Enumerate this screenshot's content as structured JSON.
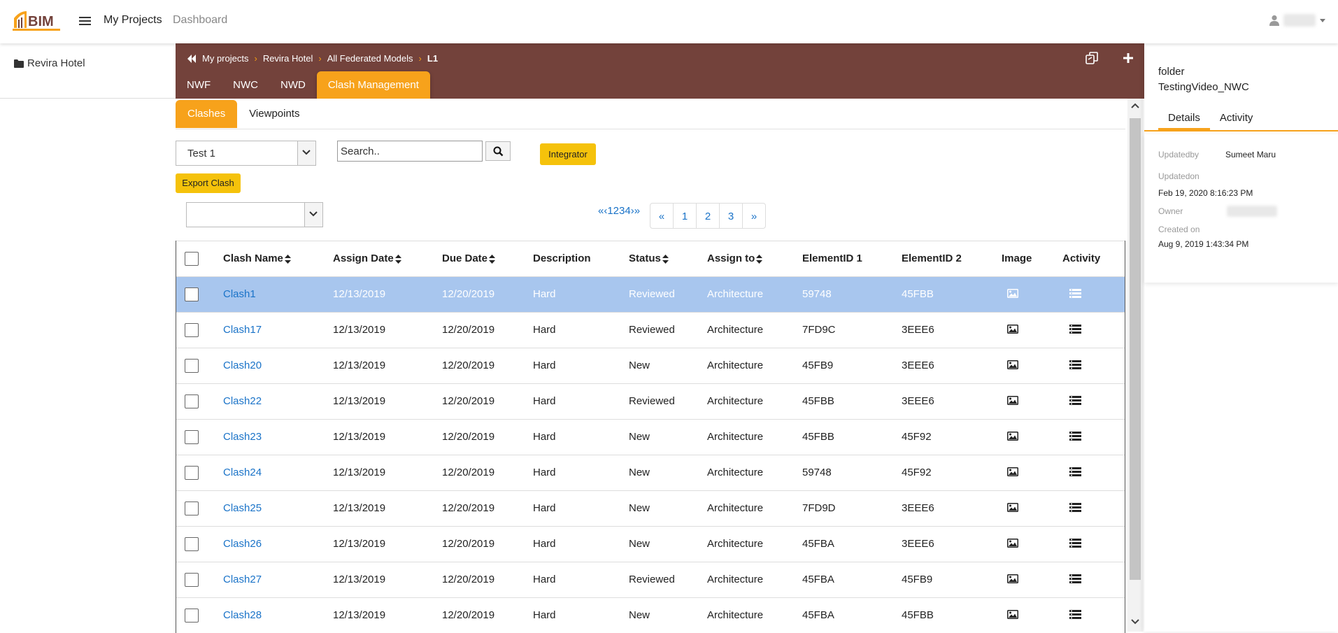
{
  "app": {
    "logo_text": "BIM",
    "nav": {
      "projects": "My Projects",
      "dashboard": "Dashboard"
    }
  },
  "sidebar": {
    "project": "Revira Hotel"
  },
  "breadcrumb": {
    "items": [
      "My projects",
      "Revira Hotel",
      "All Federated Models",
      "L1"
    ]
  },
  "tabs": [
    "NWF",
    "NWC",
    "NWD",
    "Clash Management"
  ],
  "subtabs": [
    "Clashes",
    "Viewpoints"
  ],
  "filters": {
    "test_select": "Test 1",
    "search_placeholder": "Search..",
    "integrator_label": "Integrator",
    "export_label": "Export Clash",
    "secondary_select": ""
  },
  "pagination": {
    "text": "«‹1234›»",
    "buttons": [
      "«",
      "1",
      "2",
      "3",
      "»"
    ]
  },
  "table": {
    "headers": {
      "name": "Clash Name",
      "assign_date": "Assign Date",
      "due_date": "Due Date",
      "description": "Description",
      "status": "Status",
      "assign_to": "Assign to",
      "element1": "ElementID 1",
      "element2": "ElementID 2",
      "image": "Image",
      "activity": "Activity"
    },
    "rows": [
      {
        "name": "Clash1",
        "assign": "12/13/2019",
        "due": "12/20/2019",
        "desc": "Hard",
        "status": "Reviewed",
        "to": "Architecture",
        "e1": "59748",
        "e2": "45FBB"
      },
      {
        "name": "Clash17",
        "assign": "12/13/2019",
        "due": "12/20/2019",
        "desc": "Hard",
        "status": "Reviewed",
        "to": "Architecture",
        "e1": "7FD9C",
        "e2": "3EEE6"
      },
      {
        "name": "Clash20",
        "assign": "12/13/2019",
        "due": "12/20/2019",
        "desc": "Hard",
        "status": "New",
        "to": "Architecture",
        "e1": "45FB9",
        "e2": "3EEE6"
      },
      {
        "name": "Clash22",
        "assign": "12/13/2019",
        "due": "12/20/2019",
        "desc": "Hard",
        "status": "Reviewed",
        "to": "Architecture",
        "e1": "45FBB",
        "e2": "3EEE6"
      },
      {
        "name": "Clash23",
        "assign": "12/13/2019",
        "due": "12/20/2019",
        "desc": "Hard",
        "status": "New",
        "to": "Architecture",
        "e1": "45FBB",
        "e2": "45F92"
      },
      {
        "name": "Clash24",
        "assign": "12/13/2019",
        "due": "12/20/2019",
        "desc": "Hard",
        "status": "New",
        "to": "Architecture",
        "e1": "59748",
        "e2": "45F92"
      },
      {
        "name": "Clash25",
        "assign": "12/13/2019",
        "due": "12/20/2019",
        "desc": "Hard",
        "status": "New",
        "to": "Architecture",
        "e1": "7FD9D",
        "e2": "3EEE6"
      },
      {
        "name": "Clash26",
        "assign": "12/13/2019",
        "due": "12/20/2019",
        "desc": "Hard",
        "status": "New",
        "to": "Architecture",
        "e1": "45FBA",
        "e2": "3EEE6"
      },
      {
        "name": "Clash27",
        "assign": "12/13/2019",
        "due": "12/20/2019",
        "desc": "Hard",
        "status": "Reviewed",
        "to": "Architecture",
        "e1": "45FBA",
        "e2": "45FB9"
      },
      {
        "name": "Clash28",
        "assign": "12/13/2019",
        "due": "12/20/2019",
        "desc": "Hard",
        "status": "New",
        "to": "Architecture",
        "e1": "45FBA",
        "e2": "45FBB"
      }
    ],
    "selected_row": 0
  },
  "right_panel": {
    "type": "folder",
    "name": "TestingVideo_NWC",
    "tabs": [
      "Details",
      "Activity"
    ],
    "details": {
      "updatedby_label": "Updatedby",
      "updatedby": "Sumeet Maru",
      "updatedon_label": "Updatedon",
      "updatedon": "Feb 19, 2020 8:16:23 PM",
      "owner_label": "Owner",
      "created_label": "Created on",
      "created": "Aug 9, 2019 1:43:34 PM"
    }
  },
  "colors": {
    "brown": "#73423b",
    "orange": "#f7a21b",
    "yellow": "#f5c20b",
    "link": "#1a73c8",
    "selected_row": "#a8c6ee"
  },
  "icons": [
    "logo-icon",
    "hamburger-icon",
    "user-icon",
    "folder-icon",
    "double-chevron-left-icon",
    "copy-icon",
    "plus-icon",
    "search-icon",
    "image-icon",
    "activity-list-icon",
    "sort-icon"
  ]
}
